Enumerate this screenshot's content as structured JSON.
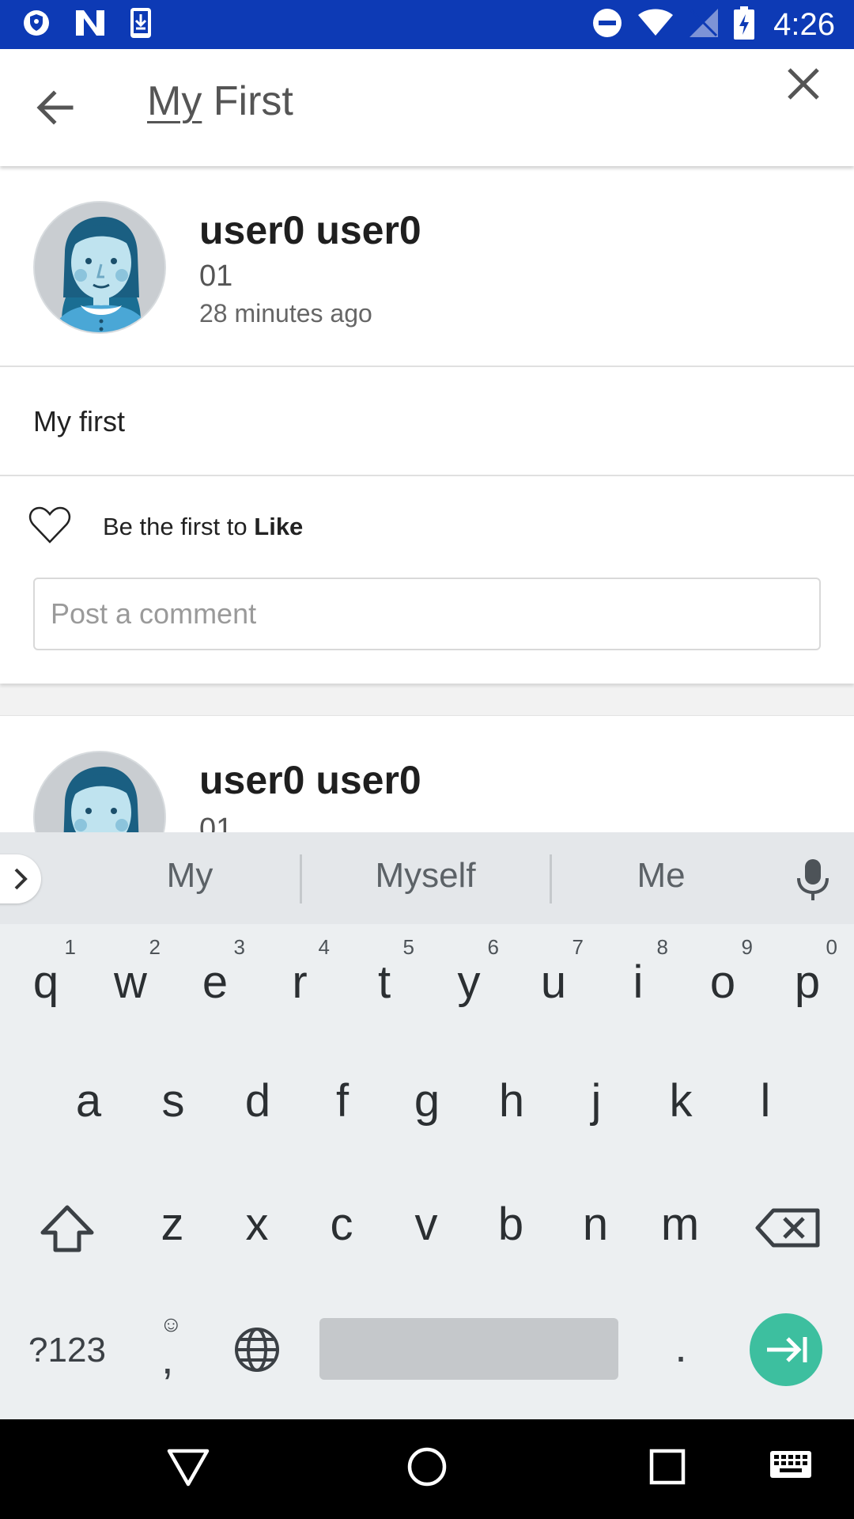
{
  "status_bar": {
    "time": "4:26",
    "left_icons": [
      "vpn-shield-icon",
      "n-notification-icon",
      "download-icon"
    ],
    "right_icons": [
      "do-not-disturb-icon",
      "wifi-icon",
      "no-signal-icon",
      "battery-charging-icon"
    ],
    "color": "#0d3ab5"
  },
  "search": {
    "query_first_word": "My",
    "query_rest": " First"
  },
  "posts": [
    {
      "author": "user0 user0",
      "subtitle": "01",
      "time_ago": "28 minutes ago",
      "text": "My first",
      "like_prefix": "Be the first to ",
      "like_bold": "Like",
      "comment_placeholder": "Post a comment"
    },
    {
      "author": "user0 user0",
      "subtitle": "01"
    }
  ],
  "keyboard": {
    "suggestions": [
      "My",
      "Myself",
      "Me"
    ],
    "row1": [
      {
        "key": "q",
        "hint": "1"
      },
      {
        "key": "w",
        "hint": "2"
      },
      {
        "key": "e",
        "hint": "3"
      },
      {
        "key": "r",
        "hint": "4"
      },
      {
        "key": "t",
        "hint": "5"
      },
      {
        "key": "y",
        "hint": "6"
      },
      {
        "key": "u",
        "hint": "7"
      },
      {
        "key": "i",
        "hint": "8"
      },
      {
        "key": "o",
        "hint": "9"
      },
      {
        "key": "p",
        "hint": "0"
      }
    ],
    "row2": [
      "a",
      "s",
      "d",
      "f",
      "g",
      "h",
      "j",
      "k",
      "l"
    ],
    "row3": [
      "z",
      "x",
      "c",
      "v",
      "b",
      "n",
      "m"
    ],
    "symbols_key": "?123",
    "comma_key": ",",
    "period_key": ".",
    "accent_color": "#3dbf9f"
  },
  "nav_bar": {
    "icons": [
      "back-triangle-icon",
      "home-circle-icon",
      "recents-square-icon",
      "keyboard-icon"
    ]
  }
}
